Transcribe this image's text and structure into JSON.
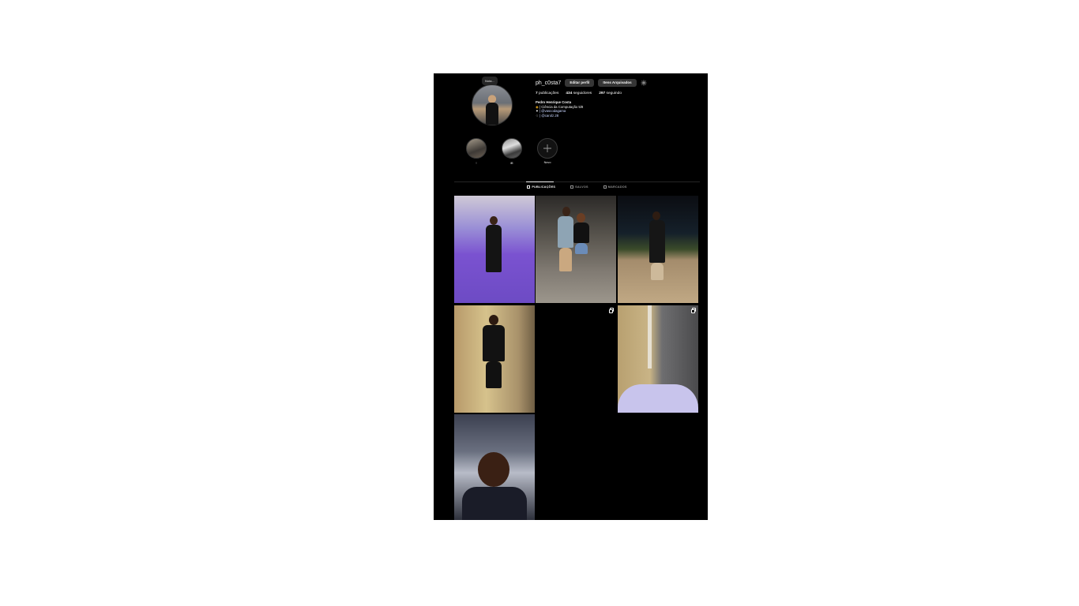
{
  "profile": {
    "note": "Nota...",
    "username": "ph_c0sta7",
    "edit_profile_label": "Editar perfil",
    "archived_label": "Itens Arquivados",
    "stats": {
      "posts_count": "7",
      "posts_label": "publicações",
      "followers_count": "434",
      "followers_label": "seguidores",
      "following_count": "297",
      "following_label": "seguindo"
    },
    "bio": {
      "full_name": "Pedro Henrique Costa",
      "line1": "| Ciência da Computação 5/8",
      "line2": "| @vascodagama",
      "line3": "| @carolz.28"
    }
  },
  "highlights": [
    {
      "label": "♢"
    },
    {
      "label": "⊞"
    },
    {
      "label": "Novo"
    }
  ],
  "tabs": [
    {
      "label": "PUBLICAÇÕES",
      "active": true
    },
    {
      "label": "SALVOS",
      "active": false
    },
    {
      "label": "MARCADOS",
      "active": false
    }
  ],
  "posts": [
    {
      "id": 1,
      "multi": false
    },
    {
      "id": 2,
      "multi": false
    },
    {
      "id": 3,
      "multi": false
    },
    {
      "id": 4,
      "multi": false
    },
    {
      "id": 5,
      "multi": true
    },
    {
      "id": 6,
      "multi": true
    },
    {
      "id": 7,
      "multi": false
    }
  ]
}
